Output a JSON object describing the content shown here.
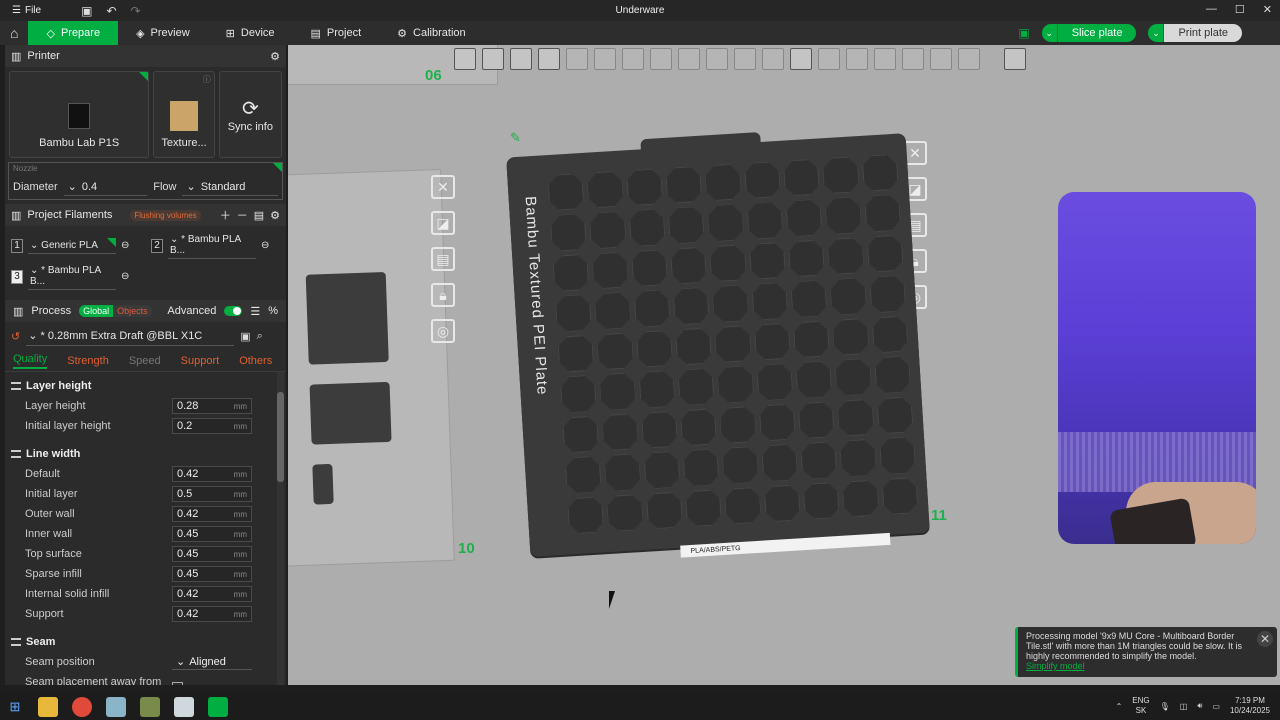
{
  "titlebar": {
    "file_label": "File",
    "app_title": "Underware"
  },
  "tabs": [
    {
      "label": "Prepare"
    },
    {
      "label": "Preview"
    },
    {
      "label": "Device"
    },
    {
      "label": "Project"
    },
    {
      "label": "Calibration"
    }
  ],
  "actions": {
    "slice": "Slice plate",
    "print": "Print plate"
  },
  "printer": {
    "header": "Printer",
    "model": "Bambu Lab P1S",
    "plate": "Texture...",
    "sync": "Sync info",
    "nozzle_label": "Nozzle",
    "diameter_label": "Diameter",
    "diameter_value": "0.4",
    "flow_label": "Flow",
    "flow_value": "Standard"
  },
  "filaments": {
    "header": "Project Filaments",
    "flushing": "Flushing volumes",
    "items": [
      {
        "num": "1",
        "name": "Generic PLA"
      },
      {
        "num": "2",
        "name": "* Bambu PLA B..."
      },
      {
        "num": "3",
        "name": "* Bambu PLA B..."
      }
    ]
  },
  "process": {
    "header": "Process",
    "global": "Global",
    "objects": "Objects",
    "advanced": "Advanced",
    "preset": "* 0.28mm Extra Draft @BBL X1C",
    "subtabs": [
      "Quality",
      "Strength",
      "Speed",
      "Support",
      "Others"
    ],
    "unit": "mm",
    "groups": [
      {
        "title": "Layer height",
        "rows": [
          {
            "label": "Layer height",
            "value": "0.28"
          },
          {
            "label": "Initial layer height",
            "value": "0.2"
          }
        ]
      },
      {
        "title": "Line width",
        "rows": [
          {
            "label": "Default",
            "value": "0.42"
          },
          {
            "label": "Initial layer",
            "value": "0.5"
          },
          {
            "label": "Outer wall",
            "value": "0.42"
          },
          {
            "label": "Inner wall",
            "value": "0.45"
          },
          {
            "label": "Top surface",
            "value": "0.45"
          },
          {
            "label": "Sparse infill",
            "value": "0.45"
          },
          {
            "label": "Internal solid infill",
            "value": "0.42"
          },
          {
            "label": "Support",
            "value": "0.42"
          }
        ]
      }
    ],
    "seam": {
      "title": "Seam",
      "position_label": "Seam position",
      "position_value": "Aligned",
      "away_label": "Seam placement away from overhangs(experimental)"
    }
  },
  "viewport": {
    "plate_numbers": [
      "06",
      "10",
      "11"
    ],
    "plate_text": "Bambu Textured PEI Plate",
    "plate_label": "PLA/ABS/PETG"
  },
  "notification": {
    "text": "Processing model '9x9 MU Core - Multiboard Border Tile.stl' with more than 1M triangles could be slow. It is highly recommended to simplify the model.",
    "link": "Simplify model"
  },
  "taskbar": {
    "lang1": "ENG",
    "lang2": "SK",
    "time": "7:19 PM",
    "date": "10/24/2025"
  },
  "colors": {
    "accent": "#00ae42",
    "sidebar": "#2b2b2b",
    "viewport": "#adadad"
  }
}
